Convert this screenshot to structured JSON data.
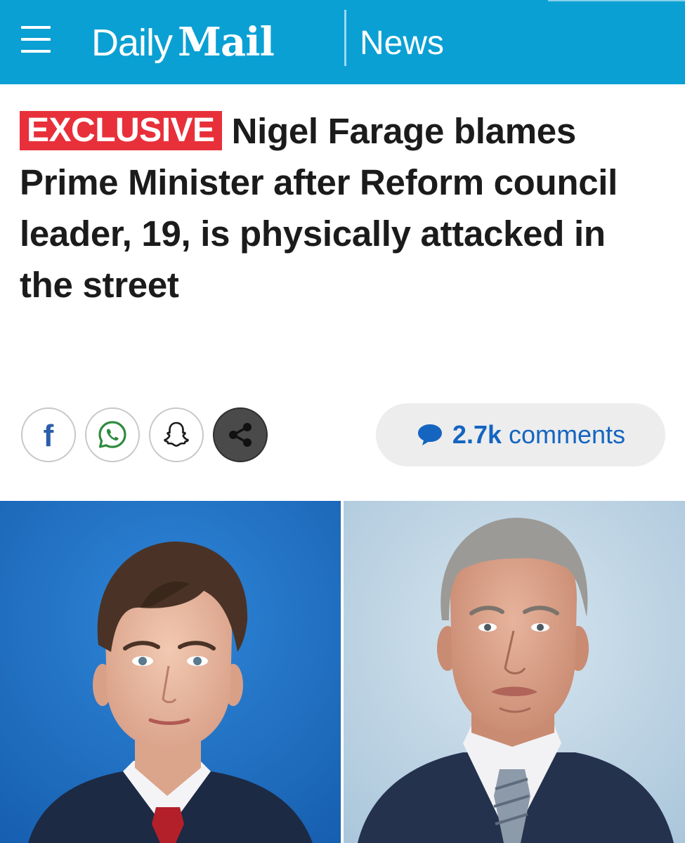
{
  "header": {
    "brand_daily": "Daily",
    "brand_mail": "Mail",
    "section": "News",
    "menu_icon": "hamburger-menu-icon",
    "background_color": "#0aa0d4"
  },
  "article": {
    "badge": "EXCLUSIVE",
    "badge_color": "#e8303a",
    "headline": "Nigel Farage blames Prime Minister after Reform council leader, 19, is physically attacked in the street"
  },
  "share": {
    "buttons": [
      {
        "icon": "facebook-icon"
      },
      {
        "icon": "whatsapp-icon"
      },
      {
        "icon": "snapchat-icon"
      },
      {
        "icon": "share-icon"
      }
    ]
  },
  "comments": {
    "icon": "speech-bubble-icon",
    "count": "2.7k",
    "label": "comments",
    "color": "#1565c0"
  },
  "images": [
    {
      "subject": "young-man-portrait",
      "background_color": "#1c6ec2"
    },
    {
      "subject": "older-man-portrait",
      "background_color": "#bcd3e4"
    }
  ]
}
